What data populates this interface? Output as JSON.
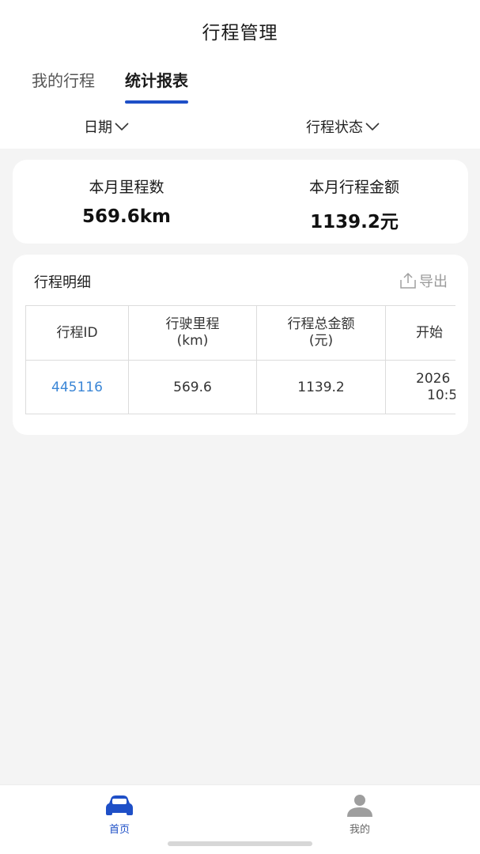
{
  "header": {
    "title": "行程管理"
  },
  "tabs": [
    {
      "label": "我的行程",
      "active": false
    },
    {
      "label": "统计报表",
      "active": true
    }
  ],
  "filters": {
    "date_label": "日期",
    "status_label": "行程状态"
  },
  "summary": {
    "mileage_label": "本月里程数",
    "mileage_value": "569.6km",
    "amount_label": "本月行程金额",
    "amount_value": "1139.2元"
  },
  "detail": {
    "title": "行程明细",
    "export_label": "导出",
    "columns": [
      {
        "line1": "行程ID",
        "line2": ""
      },
      {
        "line1": "行驶里程",
        "line2": "(km)"
      },
      {
        "line1": "行程总金额",
        "line2": "(元)"
      },
      {
        "line1": "开始",
        "line2": ""
      }
    ],
    "rows": [
      {
        "id": "445116",
        "mileage": "569.6",
        "amount": "1139.2",
        "start_line1": "2026",
        "start_line2": "10:5"
      }
    ]
  },
  "nav": {
    "home_label": "首页",
    "mine_label": "我的",
    "active_color": "#1e4fc7",
    "inactive_color": "#9e9e9e"
  },
  "colors": {
    "accent": "#1e4fc7",
    "link": "#3b86d6"
  },
  "icons": [
    "chevron-down-icon",
    "export-icon",
    "car-icon",
    "user-icon"
  ]
}
